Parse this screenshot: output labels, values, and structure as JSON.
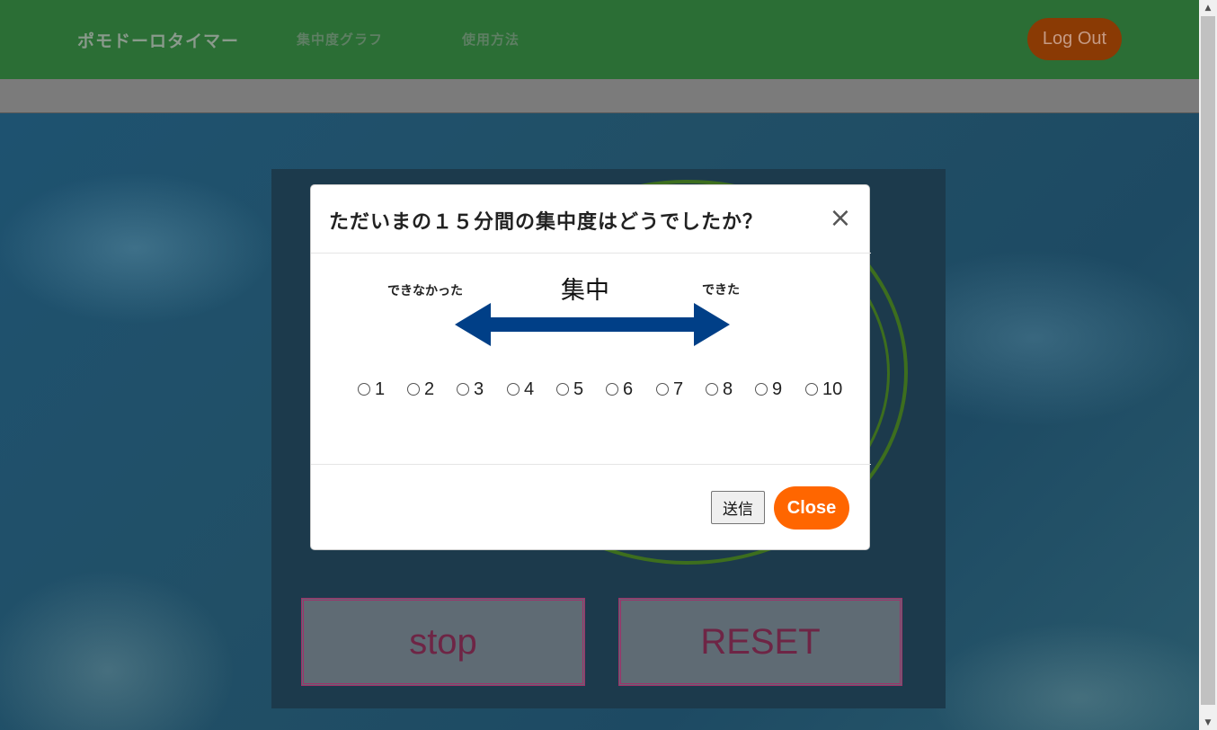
{
  "navbar": {
    "brand": "ポモドーロタイマー",
    "links": [
      "集中度グラフ",
      "使用方法"
    ],
    "logout_label": "Log Out"
  },
  "timer": {
    "stop_label": "stop",
    "reset_label": "RESET"
  },
  "modal": {
    "title": "ただいまの１５分間の集中度はどうでしたか？",
    "close_x": "×",
    "scale": {
      "left_label": "できなかった",
      "center_label": "集中",
      "right_label": "できた",
      "arrow_color": "#003f87"
    },
    "options": [
      "1",
      "2",
      "3",
      "4",
      "5",
      "6",
      "7",
      "8",
      "9",
      "10"
    ],
    "submit_label": "送信",
    "close_label": "Close"
  },
  "colors": {
    "navbar": "#2b6e35",
    "logout": "#8a3a04",
    "close_button": "#ff6600",
    "timer_ring": "#3d6e1e",
    "button_border": "#a0306a"
  },
  "scrollbar": {
    "up_icon": "▲",
    "down_icon": "▼"
  }
}
